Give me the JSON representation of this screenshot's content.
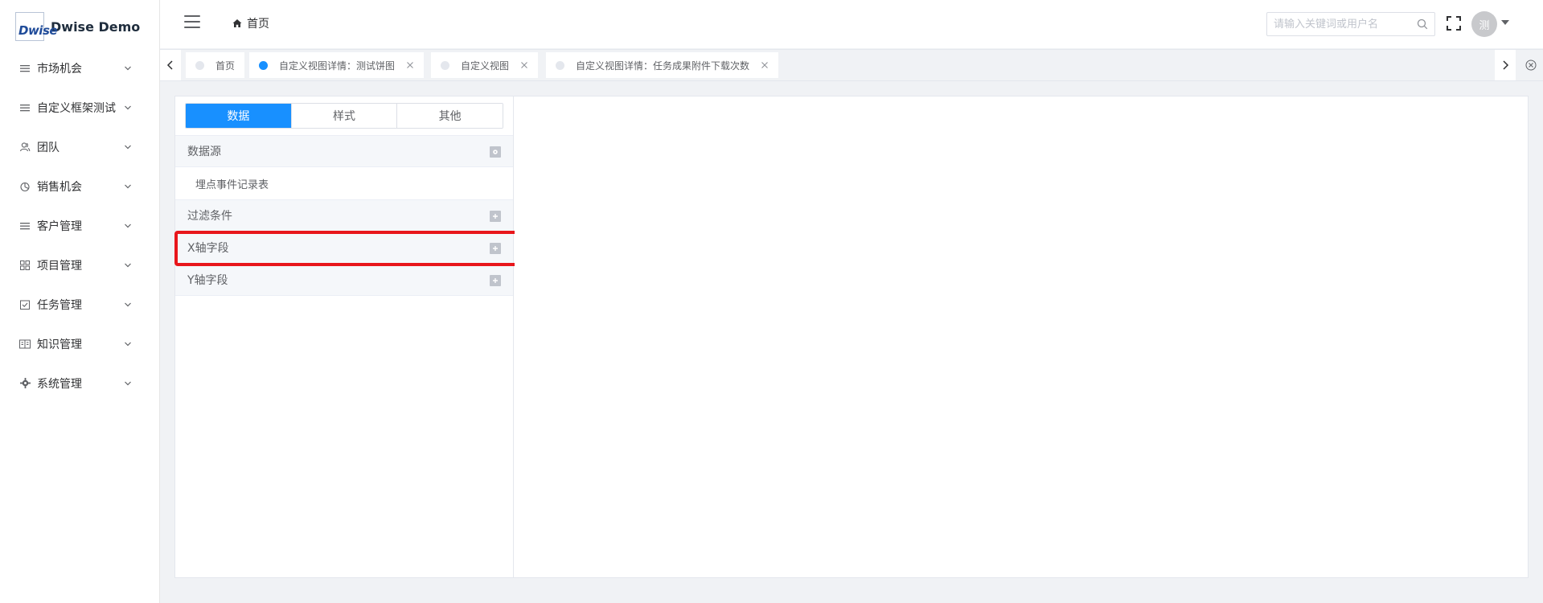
{
  "app": {
    "logo_mark": "Dwise",
    "title": "Dwise Demo"
  },
  "sidebar": {
    "items": [
      {
        "label": "市场机会",
        "icon": "list-icon"
      },
      {
        "label": "自定义框架测试",
        "icon": "list-icon"
      },
      {
        "label": "团队",
        "icon": "team-icon"
      },
      {
        "label": "销售机会",
        "icon": "pie-chart-icon"
      },
      {
        "label": "客户管理",
        "icon": "list-icon"
      },
      {
        "label": "项目管理",
        "icon": "grid-icon"
      },
      {
        "label": "任务管理",
        "icon": "checkbox-icon"
      },
      {
        "label": "知识管理",
        "icon": "book-icon"
      },
      {
        "label": "系统管理",
        "icon": "gear-icon"
      }
    ]
  },
  "header": {
    "breadcrumb": "首页",
    "search_placeholder": "请输入关键词或用户名",
    "avatar_text": "测"
  },
  "tabs": [
    {
      "label": "首页",
      "active": false,
      "closable": false
    },
    {
      "label": "自定义视图详情：测试饼图",
      "active": true,
      "closable": true
    },
    {
      "label": "自定义视图",
      "active": false,
      "closable": true
    },
    {
      "label": "自定义视图详情：任务成果附件下载次数",
      "active": false,
      "closable": true
    }
  ],
  "editor": {
    "segments": [
      "数据",
      "样式",
      "其他"
    ],
    "active_segment": 0,
    "sections": {
      "datasource": "数据源",
      "datasource_value": "埋点事件记录表",
      "filter": "过滤条件",
      "x_field": "X轴字段",
      "y_field": "Y轴字段"
    }
  },
  "colors": {
    "accent": "#1890ff",
    "highlight": "#e8161b"
  }
}
